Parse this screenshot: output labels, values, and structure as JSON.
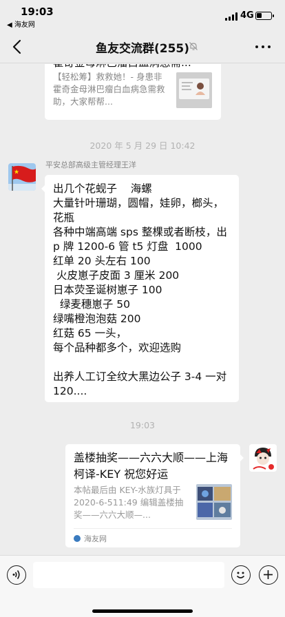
{
  "status_bar": {
    "time": "19:03",
    "back_app": "◀ 海友网",
    "network": "4G",
    "battery_level": 0.35
  },
  "header": {
    "title": "鱼友交流群(255)",
    "muted": true
  },
  "messages": {
    "shared_card_top": {
      "title_fragment": "霍奇金母淋巴瘤白血病急需...",
      "description": "【轻松筹】救救她！- 身患非霍奇金母淋巴瘤白血病急需救助，大家帮帮..."
    },
    "timestamp_1": "2020 年 5 月 29 日 10:42",
    "sender_name": "平安总部高级主管经理王洋",
    "text_message": "出几个花蚬子    海螺\n大量针叶珊瑚，圆帽，娃卵，榔头，花瓶\n各种中端高端 sps 整棵或者断枝，出 p 牌 1200-6 管 t5 灯盘  1000\n红单 20 头左右 100\n 火皮崽子皮面 3 厘米 200\n日本荧圣诞树崽子 100\n  绿麦穗崽子 50\n绿嘴橙泡泡菇 200\n红菇 65 一头，\n每个品种都多个，欢迎选购\n\n出养人工订全纹大黑边公子 3-4 一对 120....",
    "timestamp_2": "19:03",
    "link_card": {
      "title": "盖楼抽奖——六六大顺——上海柯译-KEY 祝您好运",
      "description": "本帖最后由 KEY-水族灯具于 2020-6-511:49 编辑盖楼抽奖——六六大顺—...",
      "source": "海友网"
    }
  },
  "colors": {
    "background": "#ededed",
    "bubble": "#ffffff",
    "meta_text": "#b2b2b2"
  },
  "icons": {
    "back": "chevron-left-icon",
    "mute": "bell-slash-icon",
    "more": "ellipsis-icon",
    "voice": "voice-icon",
    "emoji": "emoji-icon",
    "add": "plus-icon"
  }
}
